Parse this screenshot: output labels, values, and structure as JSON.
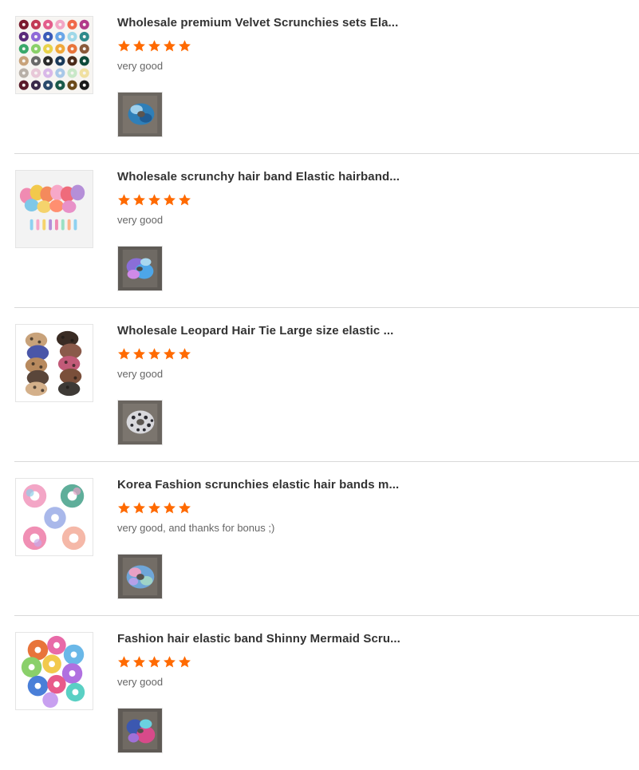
{
  "reviews": [
    {
      "title": "Wholesale premium Velvet Scrunchies sets Ela...",
      "rating": 5,
      "comment": "very good",
      "product_image": "velvet-scrunchies-grid",
      "photo_image": "blue-scrunchie-photo"
    },
    {
      "title": "Wholesale scrunchy hair band Elastic hairband...",
      "rating": 5,
      "comment": "very good",
      "product_image": "colorful-scrunchies-with-clips",
      "photo_image": "purple-scrunchie-photo"
    },
    {
      "title": "Wholesale Leopard Hair Tie Large size elastic ...",
      "rating": 5,
      "comment": "very good",
      "product_image": "leopard-scrunchies",
      "photo_image": "leopard-scrunchie-photo"
    },
    {
      "title": "Korea Fashion scrunchies elastic hair bands m...",
      "rating": 5,
      "comment": "very good, and thanks for bonus ;)",
      "product_image": "tie-dye-scrunchies",
      "photo_image": "tie-dye-scrunchie-photo"
    },
    {
      "title": "Fashion hair elastic band Shinny Mermaid Scru...",
      "rating": 5,
      "comment": "very good",
      "product_image": "mermaid-scrunchies",
      "photo_image": "mermaid-scrunchie-photo"
    }
  ],
  "colors": {
    "star": "#ff6a00",
    "divider": "#d9d9d9",
    "title": "#333333",
    "comment": "#666666"
  }
}
